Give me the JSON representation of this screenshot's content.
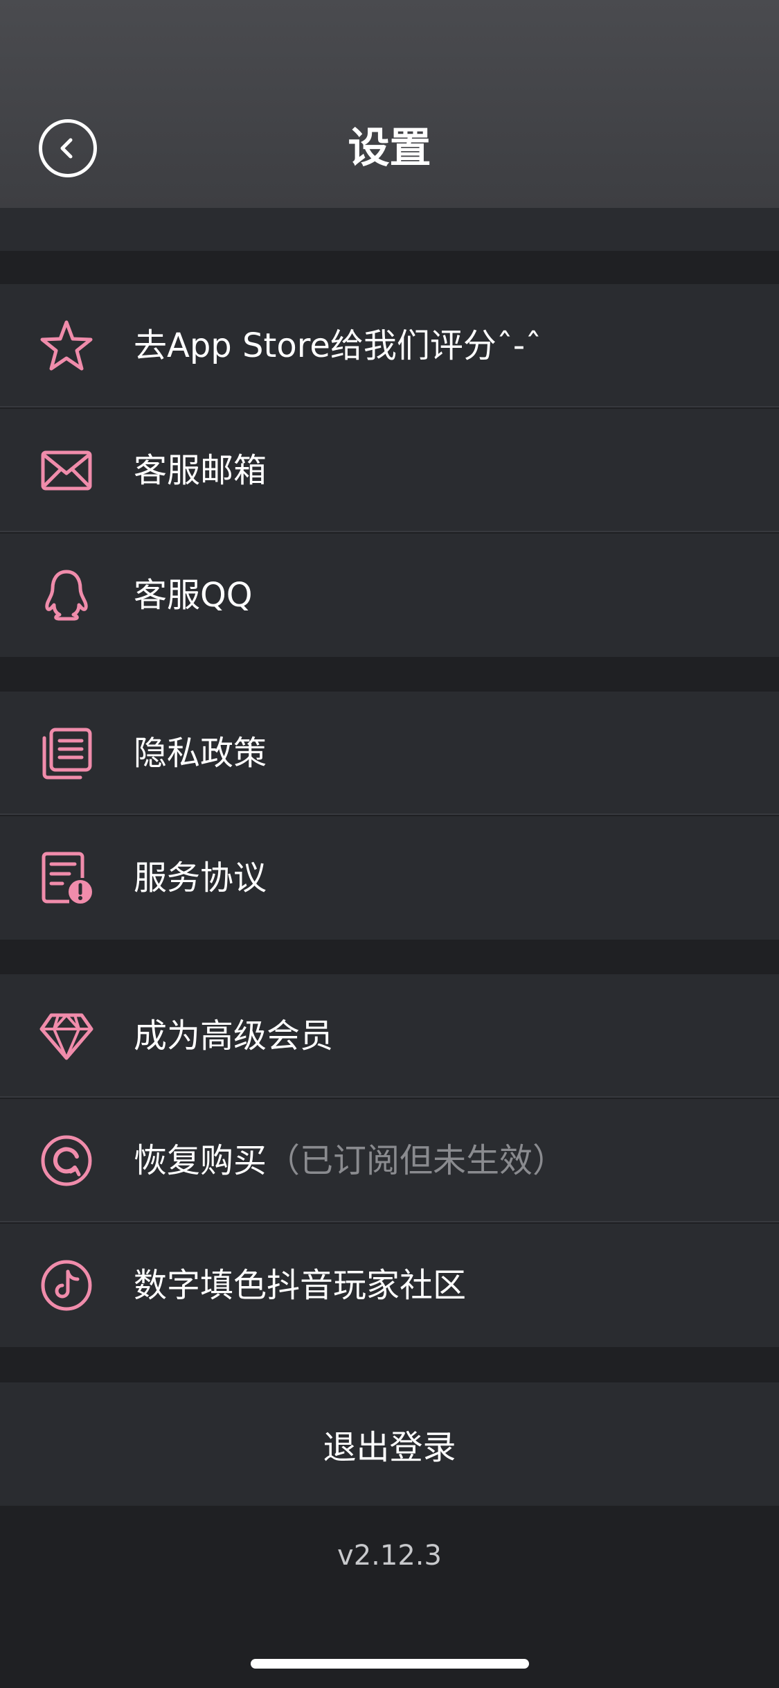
{
  "header": {
    "title": "设置"
  },
  "theme": {
    "accent": "#f08cab",
    "background": "#1f2023",
    "row_bg": "#2a2c30"
  },
  "sections": [
    {
      "items": [
        {
          "icon": "star-icon",
          "label": "去App Store给我们评分ˆ-ˆ"
        },
        {
          "icon": "mail-icon",
          "label": "客服邮箱"
        },
        {
          "icon": "qq-penguin-icon",
          "label": "客服QQ"
        }
      ]
    },
    {
      "items": [
        {
          "icon": "documents-icon",
          "label": "隐私政策"
        },
        {
          "icon": "document-alert-icon",
          "label": "服务协议"
        }
      ]
    },
    {
      "items": [
        {
          "icon": "diamond-icon",
          "label": "成为高级会员"
        },
        {
          "icon": "restore-icon",
          "label": "恢复购买",
          "hint": "（已订阅但未生效）"
        },
        {
          "icon": "tiktok-icon",
          "label": "数字填色抖音玩家社区"
        }
      ]
    }
  ],
  "logout_label": "退出登录",
  "version": "v2.12.3"
}
